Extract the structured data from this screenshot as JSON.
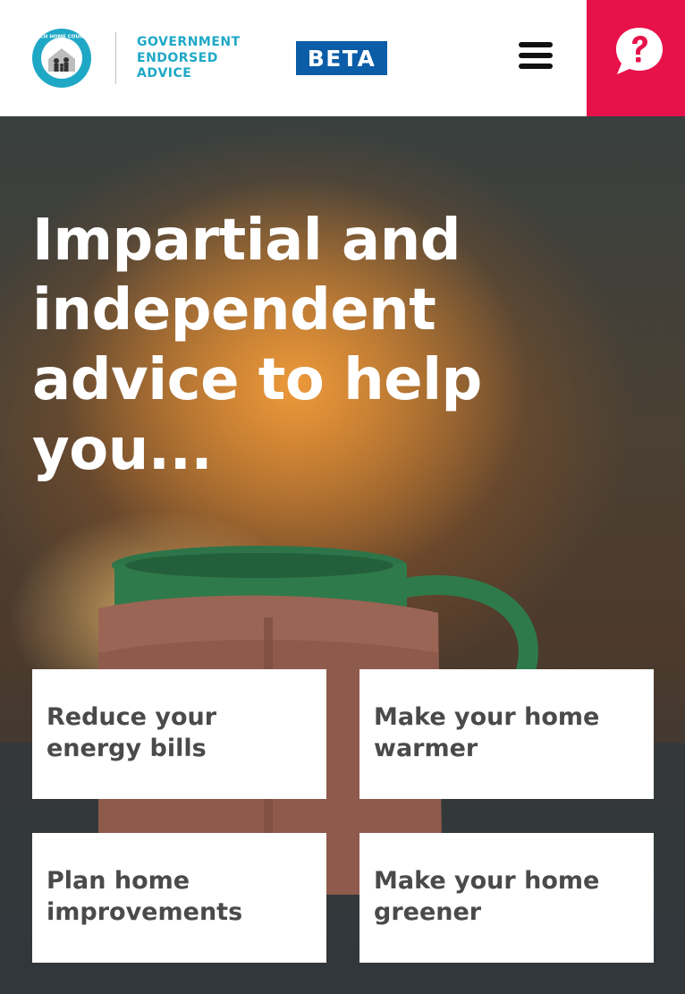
{
  "header": {
    "logo_icon": "home-family-logo-icon",
    "logo_ring_text": "EACH HOME COUNTS",
    "endorsement_lines": [
      "GOVERNMENT",
      "ENDORSED",
      "ADVICE"
    ],
    "beta_label": "BETA",
    "menu_icon": "hamburger-menu-icon",
    "help_icon": "question-speech-bubble-icon",
    "help_color": "#e8124a",
    "brand_color": "#1fa8c6",
    "beta_color": "#0b5da7"
  },
  "hero": {
    "title": "Impartial and independent advice to help you...",
    "background": "blurred fireplace with green mug in knitted cosy"
  },
  "cards": [
    {
      "label": "Reduce your\nenergy bills"
    },
    {
      "label": "Make your home\nwarmer"
    },
    {
      "label": "Plan home\nimprovements"
    },
    {
      "label": "Make your home\ngreener"
    }
  ]
}
